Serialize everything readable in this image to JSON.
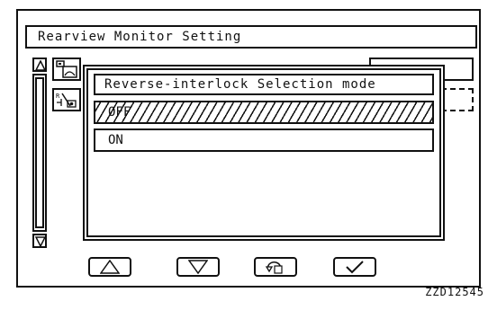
{
  "screen": {
    "title": "Rearview Monitor Setting"
  },
  "popup": {
    "title": "Reverse-interlock Selection mode",
    "options": [
      {
        "label": "OFF",
        "selected": true
      },
      {
        "label": "ON",
        "selected": false
      }
    ]
  },
  "buttons": [
    {
      "icon": "up-triangle-icon"
    },
    {
      "icon": "down-triangle-icon"
    },
    {
      "icon": "return-icon"
    },
    {
      "icon": "checkmark-icon"
    }
  ],
  "figure_code": "ZZD12545"
}
